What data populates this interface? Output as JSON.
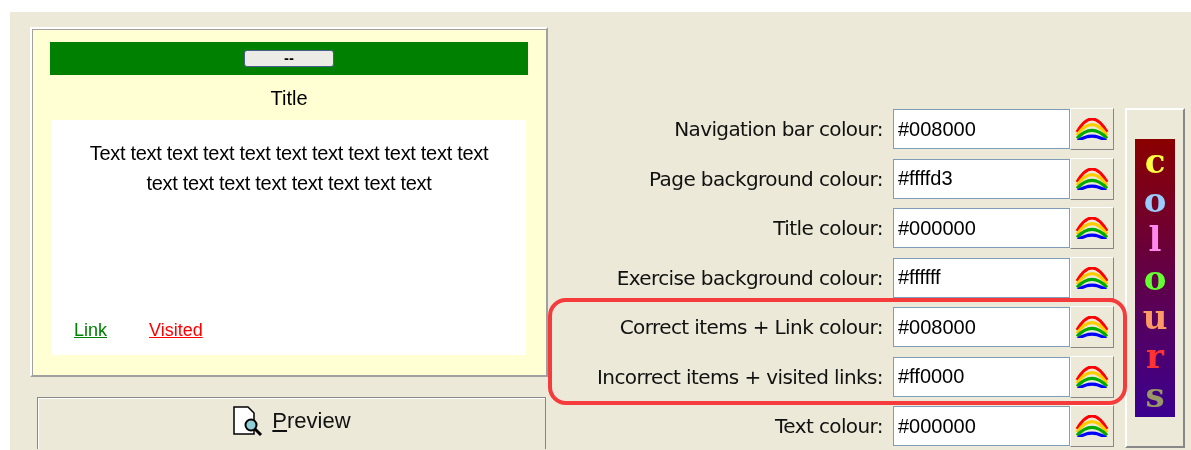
{
  "preview": {
    "nav_button": "--",
    "title": "Title",
    "body_text": "Text text text text text text text text text text text text text text text text text text text",
    "link": "Link",
    "visited": "Visited"
  },
  "preview_button": {
    "label": "Preview"
  },
  "colour_settings": [
    {
      "label": "Navigation bar colour:",
      "value": "#008000"
    },
    {
      "label": "Page background colour:",
      "value": "#ffffd3"
    },
    {
      "label": "Title colour:",
      "value": "#000000"
    },
    {
      "label": "Exercise background colour:",
      "value": "#ffffff"
    },
    {
      "label": "Correct items + Link colour:",
      "value": "#008000"
    },
    {
      "label": "Incorrect items + visited links:",
      "value": "#ff0000"
    },
    {
      "label": "Text colour:",
      "value": "#000000"
    }
  ],
  "colours_logo": [
    {
      "char": "c",
      "color": "#ffff40"
    },
    {
      "char": "o",
      "color": "#99ccff"
    },
    {
      "char": "l",
      "color": "#ff88ee"
    },
    {
      "char": "o",
      "color": "#66ff33"
    },
    {
      "char": "u",
      "color": "#ff9966"
    },
    {
      "char": "r",
      "color": "#ff3333"
    },
    {
      "char": "s",
      "color": "#999966"
    }
  ]
}
